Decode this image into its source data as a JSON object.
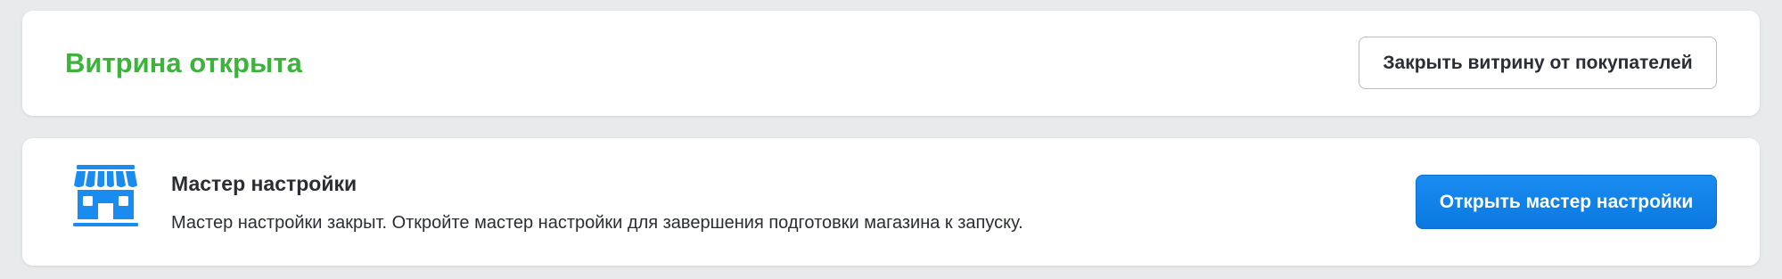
{
  "status_card": {
    "title": "Витрина открыта",
    "close_button_label": "Закрыть витрину от покупателей",
    "title_color": "#3cb43c"
  },
  "wizard_card": {
    "icon": "store-icon",
    "title": "Мастер настройки",
    "description": "Мастер настройки закрыт. Откройте мастер настройки для завершения подготовки магазина к запуску.",
    "open_button_label": "Открыть мастер настройки",
    "accent_color": "#0a78e0",
    "icon_color": "#1a8cf0"
  }
}
